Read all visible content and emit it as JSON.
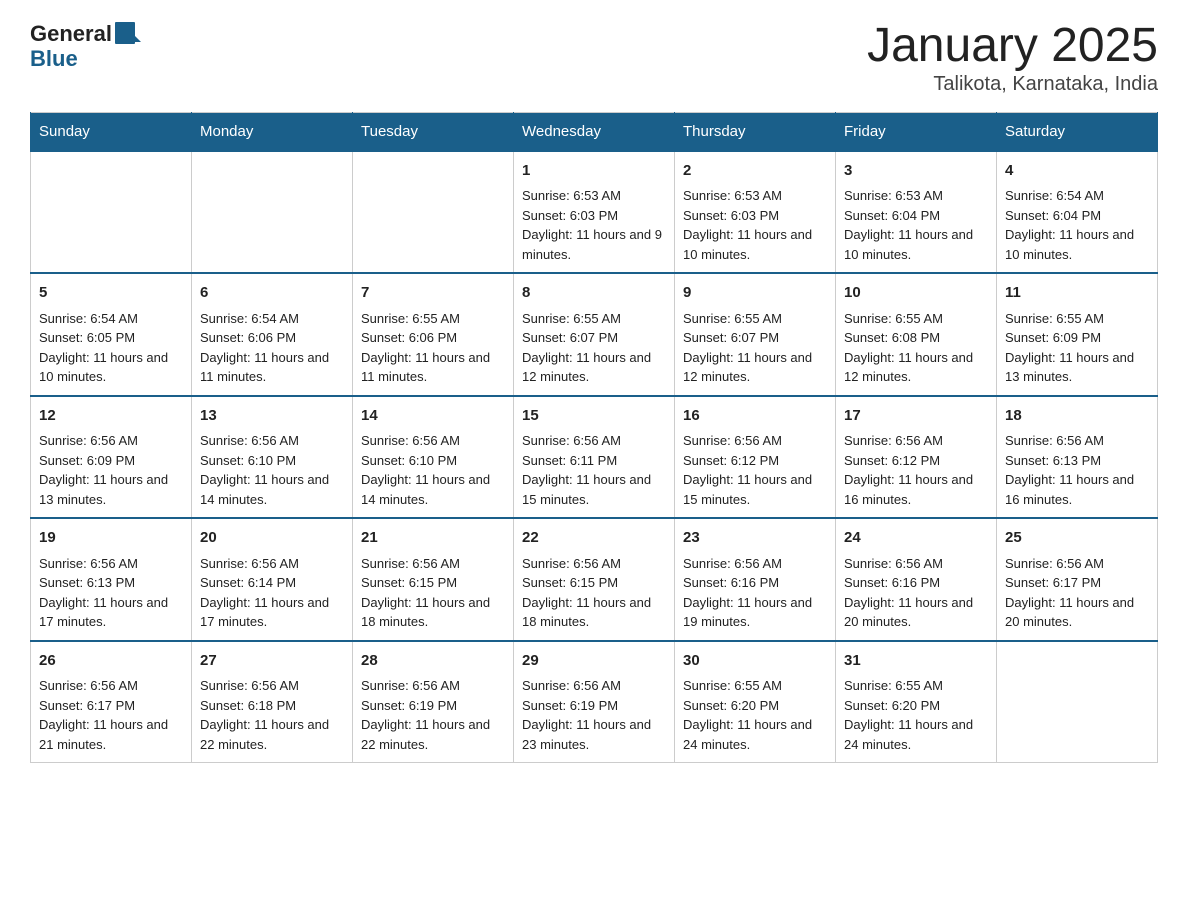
{
  "logo": {
    "general": "General",
    "blue": "Blue"
  },
  "title": "January 2025",
  "subtitle": "Talikota, Karnataka, India",
  "weekdays": [
    "Sunday",
    "Monday",
    "Tuesday",
    "Wednesday",
    "Thursday",
    "Friday",
    "Saturday"
  ],
  "weeks": [
    [
      {
        "day": "",
        "sunrise": "",
        "sunset": "",
        "daylight": ""
      },
      {
        "day": "",
        "sunrise": "",
        "sunset": "",
        "daylight": ""
      },
      {
        "day": "",
        "sunrise": "",
        "sunset": "",
        "daylight": ""
      },
      {
        "day": "1",
        "sunrise": "Sunrise: 6:53 AM",
        "sunset": "Sunset: 6:03 PM",
        "daylight": "Daylight: 11 hours and 9 minutes."
      },
      {
        "day": "2",
        "sunrise": "Sunrise: 6:53 AM",
        "sunset": "Sunset: 6:03 PM",
        "daylight": "Daylight: 11 hours and 10 minutes."
      },
      {
        "day": "3",
        "sunrise": "Sunrise: 6:53 AM",
        "sunset": "Sunset: 6:04 PM",
        "daylight": "Daylight: 11 hours and 10 minutes."
      },
      {
        "day": "4",
        "sunrise": "Sunrise: 6:54 AM",
        "sunset": "Sunset: 6:04 PM",
        "daylight": "Daylight: 11 hours and 10 minutes."
      }
    ],
    [
      {
        "day": "5",
        "sunrise": "Sunrise: 6:54 AM",
        "sunset": "Sunset: 6:05 PM",
        "daylight": "Daylight: 11 hours and 10 minutes."
      },
      {
        "day": "6",
        "sunrise": "Sunrise: 6:54 AM",
        "sunset": "Sunset: 6:06 PM",
        "daylight": "Daylight: 11 hours and 11 minutes."
      },
      {
        "day": "7",
        "sunrise": "Sunrise: 6:55 AM",
        "sunset": "Sunset: 6:06 PM",
        "daylight": "Daylight: 11 hours and 11 minutes."
      },
      {
        "day": "8",
        "sunrise": "Sunrise: 6:55 AM",
        "sunset": "Sunset: 6:07 PM",
        "daylight": "Daylight: 11 hours and 12 minutes."
      },
      {
        "day": "9",
        "sunrise": "Sunrise: 6:55 AM",
        "sunset": "Sunset: 6:07 PM",
        "daylight": "Daylight: 11 hours and 12 minutes."
      },
      {
        "day": "10",
        "sunrise": "Sunrise: 6:55 AM",
        "sunset": "Sunset: 6:08 PM",
        "daylight": "Daylight: 11 hours and 12 minutes."
      },
      {
        "day": "11",
        "sunrise": "Sunrise: 6:55 AM",
        "sunset": "Sunset: 6:09 PM",
        "daylight": "Daylight: 11 hours and 13 minutes."
      }
    ],
    [
      {
        "day": "12",
        "sunrise": "Sunrise: 6:56 AM",
        "sunset": "Sunset: 6:09 PM",
        "daylight": "Daylight: 11 hours and 13 minutes."
      },
      {
        "day": "13",
        "sunrise": "Sunrise: 6:56 AM",
        "sunset": "Sunset: 6:10 PM",
        "daylight": "Daylight: 11 hours and 14 minutes."
      },
      {
        "day": "14",
        "sunrise": "Sunrise: 6:56 AM",
        "sunset": "Sunset: 6:10 PM",
        "daylight": "Daylight: 11 hours and 14 minutes."
      },
      {
        "day": "15",
        "sunrise": "Sunrise: 6:56 AM",
        "sunset": "Sunset: 6:11 PM",
        "daylight": "Daylight: 11 hours and 15 minutes."
      },
      {
        "day": "16",
        "sunrise": "Sunrise: 6:56 AM",
        "sunset": "Sunset: 6:12 PM",
        "daylight": "Daylight: 11 hours and 15 minutes."
      },
      {
        "day": "17",
        "sunrise": "Sunrise: 6:56 AM",
        "sunset": "Sunset: 6:12 PM",
        "daylight": "Daylight: 11 hours and 16 minutes."
      },
      {
        "day": "18",
        "sunrise": "Sunrise: 6:56 AM",
        "sunset": "Sunset: 6:13 PM",
        "daylight": "Daylight: 11 hours and 16 minutes."
      }
    ],
    [
      {
        "day": "19",
        "sunrise": "Sunrise: 6:56 AM",
        "sunset": "Sunset: 6:13 PM",
        "daylight": "Daylight: 11 hours and 17 minutes."
      },
      {
        "day": "20",
        "sunrise": "Sunrise: 6:56 AM",
        "sunset": "Sunset: 6:14 PM",
        "daylight": "Daylight: 11 hours and 17 minutes."
      },
      {
        "day": "21",
        "sunrise": "Sunrise: 6:56 AM",
        "sunset": "Sunset: 6:15 PM",
        "daylight": "Daylight: 11 hours and 18 minutes."
      },
      {
        "day": "22",
        "sunrise": "Sunrise: 6:56 AM",
        "sunset": "Sunset: 6:15 PM",
        "daylight": "Daylight: 11 hours and 18 minutes."
      },
      {
        "day": "23",
        "sunrise": "Sunrise: 6:56 AM",
        "sunset": "Sunset: 6:16 PM",
        "daylight": "Daylight: 11 hours and 19 minutes."
      },
      {
        "day": "24",
        "sunrise": "Sunrise: 6:56 AM",
        "sunset": "Sunset: 6:16 PM",
        "daylight": "Daylight: 11 hours and 20 minutes."
      },
      {
        "day": "25",
        "sunrise": "Sunrise: 6:56 AM",
        "sunset": "Sunset: 6:17 PM",
        "daylight": "Daylight: 11 hours and 20 minutes."
      }
    ],
    [
      {
        "day": "26",
        "sunrise": "Sunrise: 6:56 AM",
        "sunset": "Sunset: 6:17 PM",
        "daylight": "Daylight: 11 hours and 21 minutes."
      },
      {
        "day": "27",
        "sunrise": "Sunrise: 6:56 AM",
        "sunset": "Sunset: 6:18 PM",
        "daylight": "Daylight: 11 hours and 22 minutes."
      },
      {
        "day": "28",
        "sunrise": "Sunrise: 6:56 AM",
        "sunset": "Sunset: 6:19 PM",
        "daylight": "Daylight: 11 hours and 22 minutes."
      },
      {
        "day": "29",
        "sunrise": "Sunrise: 6:56 AM",
        "sunset": "Sunset: 6:19 PM",
        "daylight": "Daylight: 11 hours and 23 minutes."
      },
      {
        "day": "30",
        "sunrise": "Sunrise: 6:55 AM",
        "sunset": "Sunset: 6:20 PM",
        "daylight": "Daylight: 11 hours and 24 minutes."
      },
      {
        "day": "31",
        "sunrise": "Sunrise: 6:55 AM",
        "sunset": "Sunset: 6:20 PM",
        "daylight": "Daylight: 11 hours and 24 minutes."
      },
      {
        "day": "",
        "sunrise": "",
        "sunset": "",
        "daylight": ""
      }
    ]
  ]
}
